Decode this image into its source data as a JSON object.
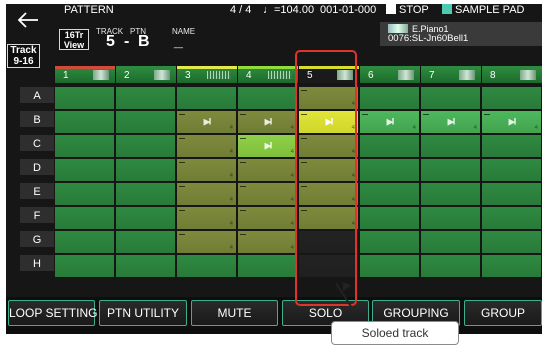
{
  "header": {
    "title": "PATTERN",
    "time_signature": "4 / 4",
    "tempo": "♩=104.00",
    "position": "001-01-000",
    "transport": "STOP",
    "sample_pad": "SAMPLE PAD"
  },
  "info": {
    "track_group": {
      "line1": "Track",
      "line2": "9-16"
    },
    "view_16tr": {
      "line1": "16Tr",
      "line2": "View"
    },
    "track_label": "TRACK",
    "ptn_label": "PTN",
    "name_label": "NAME",
    "track_value": "5",
    "dash": "-",
    "ptn_value": "B",
    "name_value": "_",
    "instrument_name": "E.Piano1",
    "instrument_tone": "0076:SL-Jn60Bell1"
  },
  "columns": [
    {
      "number": "1",
      "icon": "tone-thumbnail-icon"
    },
    {
      "number": "2",
      "icon": "tone-thumbnail-icon"
    },
    {
      "number": "3",
      "icon": "waveform-icon"
    },
    {
      "number": "4",
      "icon": "waveform-icon"
    },
    {
      "number": "5",
      "icon": "tone-thumbnail-icon"
    },
    {
      "number": "6",
      "icon": "tone-thumbnail-icon"
    },
    {
      "number": "7",
      "icon": "tone-thumbnail-icon"
    },
    {
      "number": "8",
      "icon": "tone-thumbnail-icon"
    }
  ],
  "rows": [
    "A",
    "B",
    "C",
    "D",
    "E",
    "F",
    "G",
    "H"
  ],
  "cell_end_marker": "4",
  "play_icon": "▶II",
  "function_buttons": [
    "LOOP SETTING",
    "PTN UTILITY",
    "MUTE",
    "SOLO",
    "GROUPING",
    "GROUP"
  ],
  "callout": "Soloed track",
  "colors": {
    "background": "#161616",
    "track_green": "#2f8a41",
    "pattern_olive": "#7f8a3c",
    "selected_yellow": "#d8dc2a",
    "solo_frame": "#e0332a",
    "button_border": "#3fae8f"
  }
}
